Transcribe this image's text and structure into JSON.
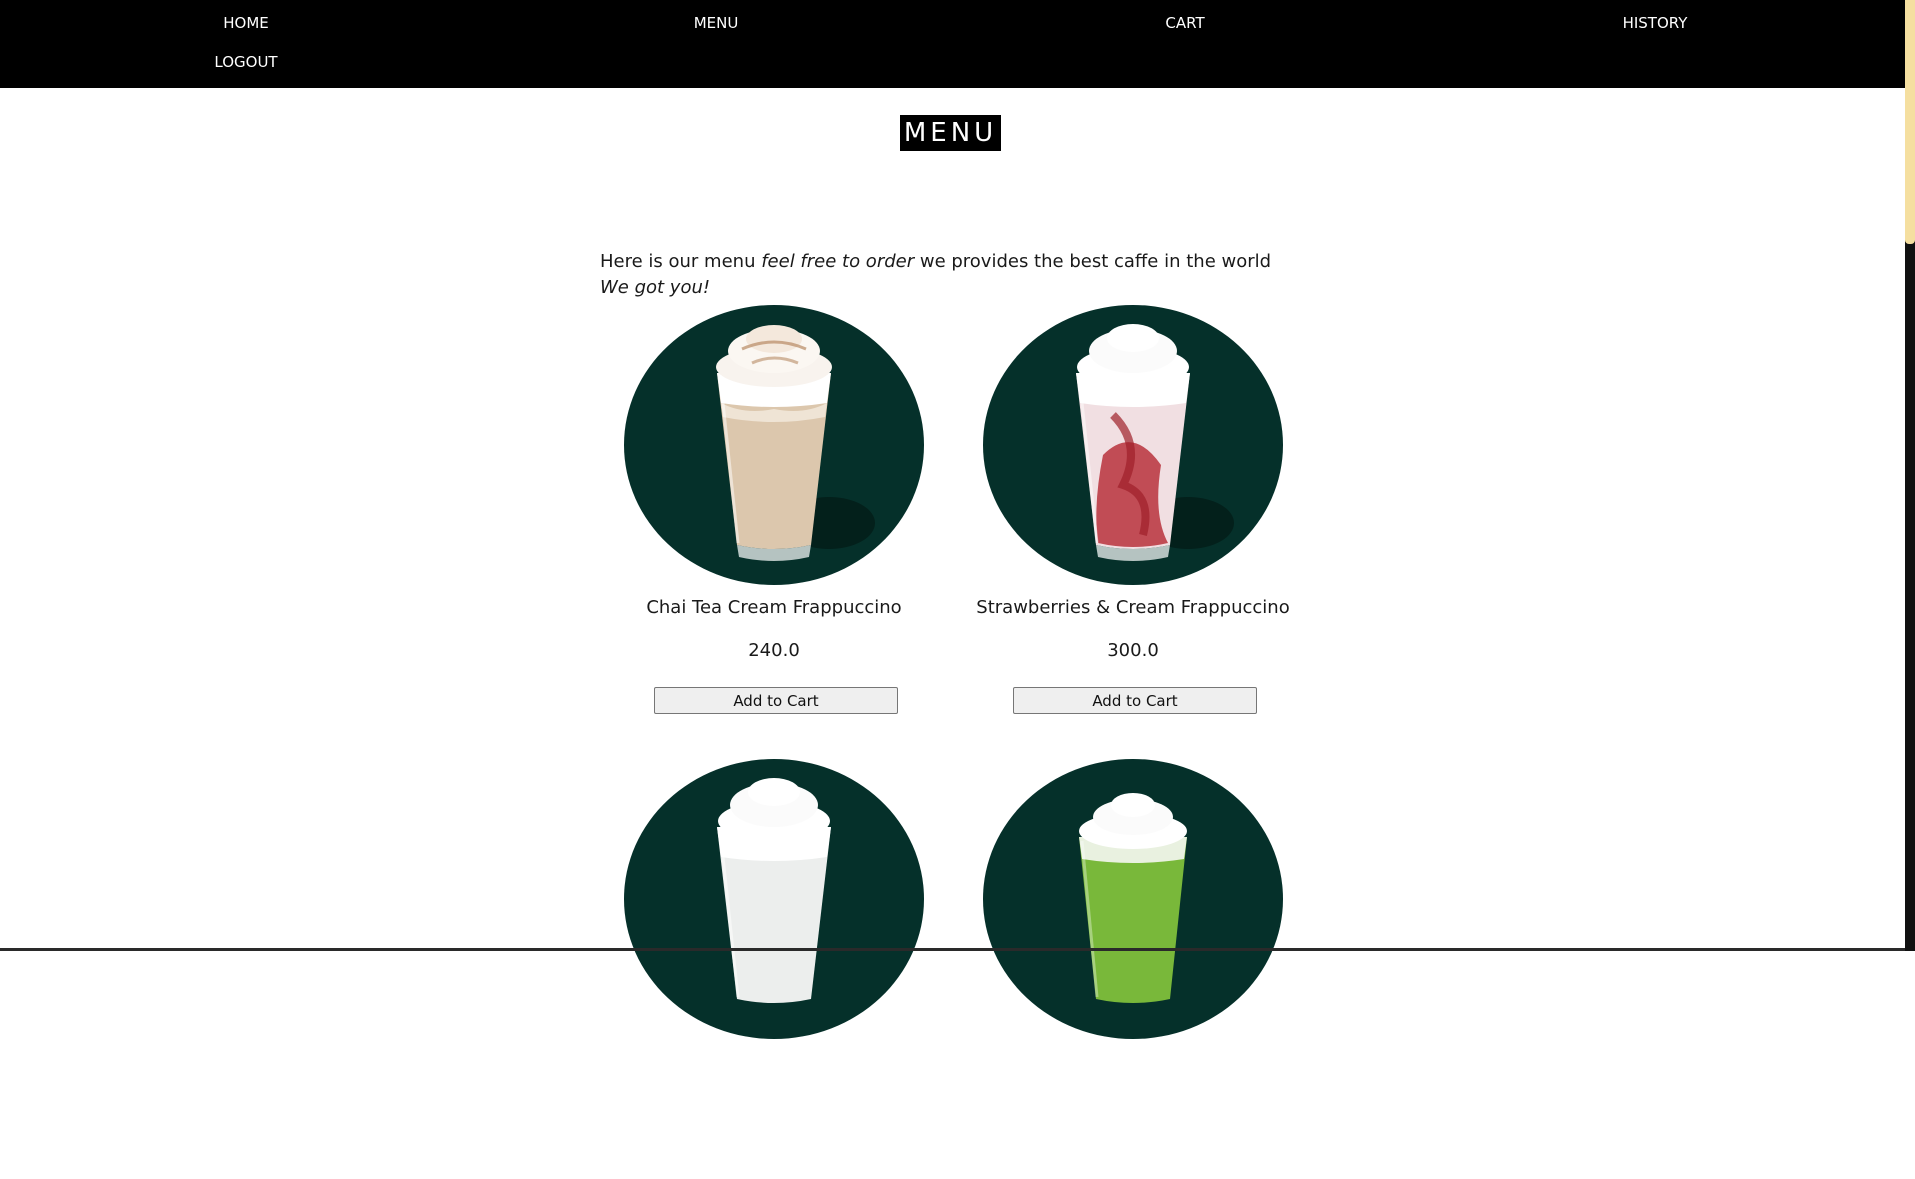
{
  "nav": {
    "home": "HOME",
    "menu": "MENU",
    "cart": "CART",
    "history": "HISTORY",
    "logout": "LOGOUT"
  },
  "page": {
    "title": "MENU",
    "intro_start": "Here is our menu ",
    "intro_em1": "feel free to order",
    "intro_mid": " we provides the best caffe in the world ",
    "intro_em2": "We got you!"
  },
  "products": [
    {
      "name": "Chai Tea Cream Frappuccino",
      "price": "240.0",
      "button": "Add to Cart"
    },
    {
      "name": "Strawberries & Cream Frappuccino",
      "price": "300.0",
      "button": "Add to Cart"
    },
    {
      "name": "",
      "price": "",
      "button": ""
    },
    {
      "name": "",
      "price": "",
      "button": ""
    }
  ],
  "colors": {
    "navbar": "#000000",
    "image_bg": "#05302a",
    "scroll_thumb": "#f5dfa0"
  }
}
